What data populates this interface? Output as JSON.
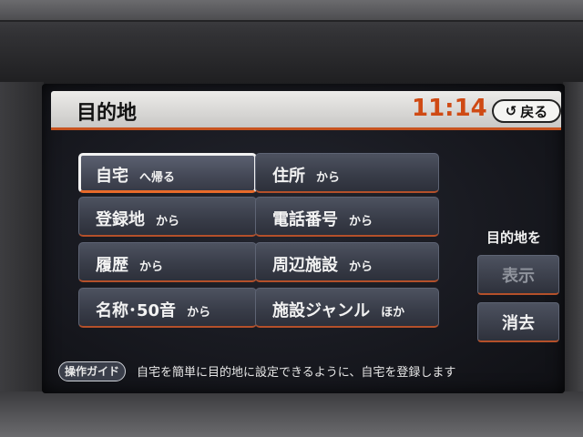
{
  "header": {
    "title": "目的地",
    "clock": "11:14",
    "back_label": "戻る"
  },
  "menu": {
    "items": [
      {
        "main": "自宅",
        "sub": "へ帰る",
        "selected": true
      },
      {
        "main": "住所",
        "sub": "から"
      },
      {
        "main": "登録地",
        "sub": "から"
      },
      {
        "main": "電話番号",
        "sub": "から"
      },
      {
        "main": "履歴",
        "sub": "から"
      },
      {
        "main": "周辺施設",
        "sub": "から"
      },
      {
        "main": "名称･50音",
        "sub": "から"
      },
      {
        "main": "施設ジャンル",
        "sub": "ほか"
      }
    ]
  },
  "side": {
    "label": "目的地を",
    "show_label": "表示",
    "erase_label": "消去"
  },
  "guide": {
    "badge": "操作ガイド",
    "text": "自宅を簡単に目的地に設定できるように、自宅を登録します"
  },
  "colors": {
    "accent": "#cf4a14",
    "button_bg": "#393d49",
    "header_bg": "#e6e5e3"
  }
}
